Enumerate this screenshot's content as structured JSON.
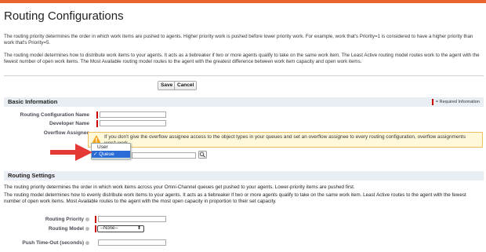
{
  "page": {
    "title": "Routing Configurations",
    "intro_priority": "The routing priority determines the order in which work items are pushed to agents. Higher priority work is pushed before lower priority work. For example, work that's Priority=1 is considered to have a higher priority than work that's Priority=5.",
    "intro_model": "The routing model determines how to distribute work items to your agents. It acts as a tiebreaker if two or more agents qualify to take on the same work item. The Least Active routing model routes work to the agent with the fewest number of open work items. The Most Available routing model routes to the agent with the greatest difference between work item capacity and open work items."
  },
  "toolbar": {
    "save_label": "Save",
    "cancel_label": "Cancel"
  },
  "basic_info": {
    "heading": "Basic Information",
    "required_info": "= Required Information",
    "routing_configuration_name_label": "Routing Configuration Name",
    "developer_name_label": "Developer Name",
    "overflow_assignee_label": "Overflow Assignee",
    "warning": "If you don't give the overflow assignee access to the object types in your queues and set an overflow assignee to every routing configuration, overflow assignments won't work.",
    "dropdown_options": [
      "User",
      "Queue"
    ],
    "dropdown_selected_mark": "✓",
    "lookup_icon": "lookup-icon"
  },
  "routing_settings": {
    "heading": "Routing Settings",
    "para1": "The routing priority determines the order in which work items across your Omni-Channel queues get pushed to your agents. Lower-priority items are pushed first.",
    "para2": "The routing model determines how to evenly distribute work items to your agents. It acts as a tiebreaker if two or more agents qualify to take on the same work item. Least Active routes to the agent with the fewest number of open work items. Most Available routes to the agent with the most open capacity in proportion to their set capacity.",
    "routing_priority_label": "Routing Priority",
    "routing_model_label": "Routing Model",
    "routing_model_value": "--None--",
    "push_timeout_label": "Push Time-Out (seconds)"
  },
  "colors": {
    "accent_orange": "#e9642f",
    "section_bg": "#e8eef4",
    "required_red": "#cc0000",
    "selected_blue": "#2b6bd6",
    "arrow_red": "#e53935"
  }
}
